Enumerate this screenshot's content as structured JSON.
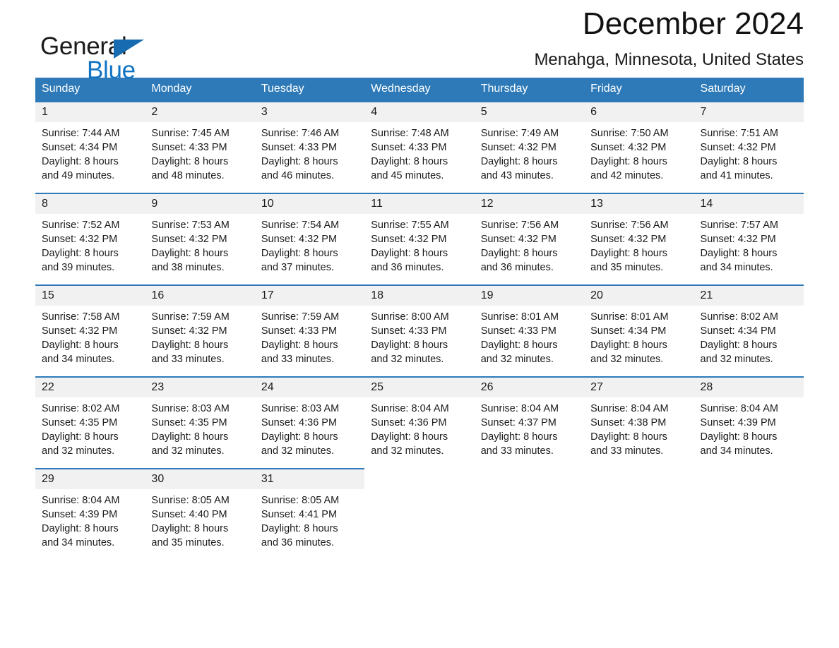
{
  "brand": {
    "name_part1": "General",
    "name_part2": "Blue",
    "triangle_icon": "triangle-icon",
    "color_blue": "#1275c4",
    "color_triangle": "#176bb0"
  },
  "header": {
    "title": "December 2024",
    "subtitle": "Menahga, Minnesota, United States"
  },
  "theme": {
    "header_blue": "#2e7ab8",
    "day_band": "#f1f1f1",
    "text": "#1b1b1b"
  },
  "weekdays": [
    "Sunday",
    "Monday",
    "Tuesday",
    "Wednesday",
    "Thursday",
    "Friday",
    "Saturday"
  ],
  "weeks": [
    {
      "days": [
        {
          "num": "1",
          "sunrise": "Sunrise: 7:44 AM",
          "sunset": "Sunset: 4:34 PM",
          "daylight_1": "Daylight: 8 hours",
          "daylight_2": "and 49 minutes."
        },
        {
          "num": "2",
          "sunrise": "Sunrise: 7:45 AM",
          "sunset": "Sunset: 4:33 PM",
          "daylight_1": "Daylight: 8 hours",
          "daylight_2": "and 48 minutes."
        },
        {
          "num": "3",
          "sunrise": "Sunrise: 7:46 AM",
          "sunset": "Sunset: 4:33 PM",
          "daylight_1": "Daylight: 8 hours",
          "daylight_2": "and 46 minutes."
        },
        {
          "num": "4",
          "sunrise": "Sunrise: 7:48 AM",
          "sunset": "Sunset: 4:33 PM",
          "daylight_1": "Daylight: 8 hours",
          "daylight_2": "and 45 minutes."
        },
        {
          "num": "5",
          "sunrise": "Sunrise: 7:49 AM",
          "sunset": "Sunset: 4:32 PM",
          "daylight_1": "Daylight: 8 hours",
          "daylight_2": "and 43 minutes."
        },
        {
          "num": "6",
          "sunrise": "Sunrise: 7:50 AM",
          "sunset": "Sunset: 4:32 PM",
          "daylight_1": "Daylight: 8 hours",
          "daylight_2": "and 42 minutes."
        },
        {
          "num": "7",
          "sunrise": "Sunrise: 7:51 AM",
          "sunset": "Sunset: 4:32 PM",
          "daylight_1": "Daylight: 8 hours",
          "daylight_2": "and 41 minutes."
        }
      ]
    },
    {
      "days": [
        {
          "num": "8",
          "sunrise": "Sunrise: 7:52 AM",
          "sunset": "Sunset: 4:32 PM",
          "daylight_1": "Daylight: 8 hours",
          "daylight_2": "and 39 minutes."
        },
        {
          "num": "9",
          "sunrise": "Sunrise: 7:53 AM",
          "sunset": "Sunset: 4:32 PM",
          "daylight_1": "Daylight: 8 hours",
          "daylight_2": "and 38 minutes."
        },
        {
          "num": "10",
          "sunrise": "Sunrise: 7:54 AM",
          "sunset": "Sunset: 4:32 PM",
          "daylight_1": "Daylight: 8 hours",
          "daylight_2": "and 37 minutes."
        },
        {
          "num": "11",
          "sunrise": "Sunrise: 7:55 AM",
          "sunset": "Sunset: 4:32 PM",
          "daylight_1": "Daylight: 8 hours",
          "daylight_2": "and 36 minutes."
        },
        {
          "num": "12",
          "sunrise": "Sunrise: 7:56 AM",
          "sunset": "Sunset: 4:32 PM",
          "daylight_1": "Daylight: 8 hours",
          "daylight_2": "and 36 minutes."
        },
        {
          "num": "13",
          "sunrise": "Sunrise: 7:56 AM",
          "sunset": "Sunset: 4:32 PM",
          "daylight_1": "Daylight: 8 hours",
          "daylight_2": "and 35 minutes."
        },
        {
          "num": "14",
          "sunrise": "Sunrise: 7:57 AM",
          "sunset": "Sunset: 4:32 PM",
          "daylight_1": "Daylight: 8 hours",
          "daylight_2": "and 34 minutes."
        }
      ]
    },
    {
      "days": [
        {
          "num": "15",
          "sunrise": "Sunrise: 7:58 AM",
          "sunset": "Sunset: 4:32 PM",
          "daylight_1": "Daylight: 8 hours",
          "daylight_2": "and 34 minutes."
        },
        {
          "num": "16",
          "sunrise": "Sunrise: 7:59 AM",
          "sunset": "Sunset: 4:32 PM",
          "daylight_1": "Daylight: 8 hours",
          "daylight_2": "and 33 minutes."
        },
        {
          "num": "17",
          "sunrise": "Sunrise: 7:59 AM",
          "sunset": "Sunset: 4:33 PM",
          "daylight_1": "Daylight: 8 hours",
          "daylight_2": "and 33 minutes."
        },
        {
          "num": "18",
          "sunrise": "Sunrise: 8:00 AM",
          "sunset": "Sunset: 4:33 PM",
          "daylight_1": "Daylight: 8 hours",
          "daylight_2": "and 32 minutes."
        },
        {
          "num": "19",
          "sunrise": "Sunrise: 8:01 AM",
          "sunset": "Sunset: 4:33 PM",
          "daylight_1": "Daylight: 8 hours",
          "daylight_2": "and 32 minutes."
        },
        {
          "num": "20",
          "sunrise": "Sunrise: 8:01 AM",
          "sunset": "Sunset: 4:34 PM",
          "daylight_1": "Daylight: 8 hours",
          "daylight_2": "and 32 minutes."
        },
        {
          "num": "21",
          "sunrise": "Sunrise: 8:02 AM",
          "sunset": "Sunset: 4:34 PM",
          "daylight_1": "Daylight: 8 hours",
          "daylight_2": "and 32 minutes."
        }
      ]
    },
    {
      "days": [
        {
          "num": "22",
          "sunrise": "Sunrise: 8:02 AM",
          "sunset": "Sunset: 4:35 PM",
          "daylight_1": "Daylight: 8 hours",
          "daylight_2": "and 32 minutes."
        },
        {
          "num": "23",
          "sunrise": "Sunrise: 8:03 AM",
          "sunset": "Sunset: 4:35 PM",
          "daylight_1": "Daylight: 8 hours",
          "daylight_2": "and 32 minutes."
        },
        {
          "num": "24",
          "sunrise": "Sunrise: 8:03 AM",
          "sunset": "Sunset: 4:36 PM",
          "daylight_1": "Daylight: 8 hours",
          "daylight_2": "and 32 minutes."
        },
        {
          "num": "25",
          "sunrise": "Sunrise: 8:04 AM",
          "sunset": "Sunset: 4:36 PM",
          "daylight_1": "Daylight: 8 hours",
          "daylight_2": "and 32 minutes."
        },
        {
          "num": "26",
          "sunrise": "Sunrise: 8:04 AM",
          "sunset": "Sunset: 4:37 PM",
          "daylight_1": "Daylight: 8 hours",
          "daylight_2": "and 33 minutes."
        },
        {
          "num": "27",
          "sunrise": "Sunrise: 8:04 AM",
          "sunset": "Sunset: 4:38 PM",
          "daylight_1": "Daylight: 8 hours",
          "daylight_2": "and 33 minutes."
        },
        {
          "num": "28",
          "sunrise": "Sunrise: 8:04 AM",
          "sunset": "Sunset: 4:39 PM",
          "daylight_1": "Daylight: 8 hours",
          "daylight_2": "and 34 minutes."
        }
      ]
    },
    {
      "days": [
        {
          "num": "29",
          "sunrise": "Sunrise: 8:04 AM",
          "sunset": "Sunset: 4:39 PM",
          "daylight_1": "Daylight: 8 hours",
          "daylight_2": "and 34 minutes."
        },
        {
          "num": "30",
          "sunrise": "Sunrise: 8:05 AM",
          "sunset": "Sunset: 4:40 PM",
          "daylight_1": "Daylight: 8 hours",
          "daylight_2": "and 35 minutes."
        },
        {
          "num": "31",
          "sunrise": "Sunrise: 8:05 AM",
          "sunset": "Sunset: 4:41 PM",
          "daylight_1": "Daylight: 8 hours",
          "daylight_2": "and 36 minutes."
        },
        {
          "num": "",
          "sunrise": "",
          "sunset": "",
          "daylight_1": "",
          "daylight_2": ""
        },
        {
          "num": "",
          "sunrise": "",
          "sunset": "",
          "daylight_1": "",
          "daylight_2": ""
        },
        {
          "num": "",
          "sunrise": "",
          "sunset": "",
          "daylight_1": "",
          "daylight_2": ""
        },
        {
          "num": "",
          "sunrise": "",
          "sunset": "",
          "daylight_1": "",
          "daylight_2": ""
        }
      ]
    }
  ]
}
